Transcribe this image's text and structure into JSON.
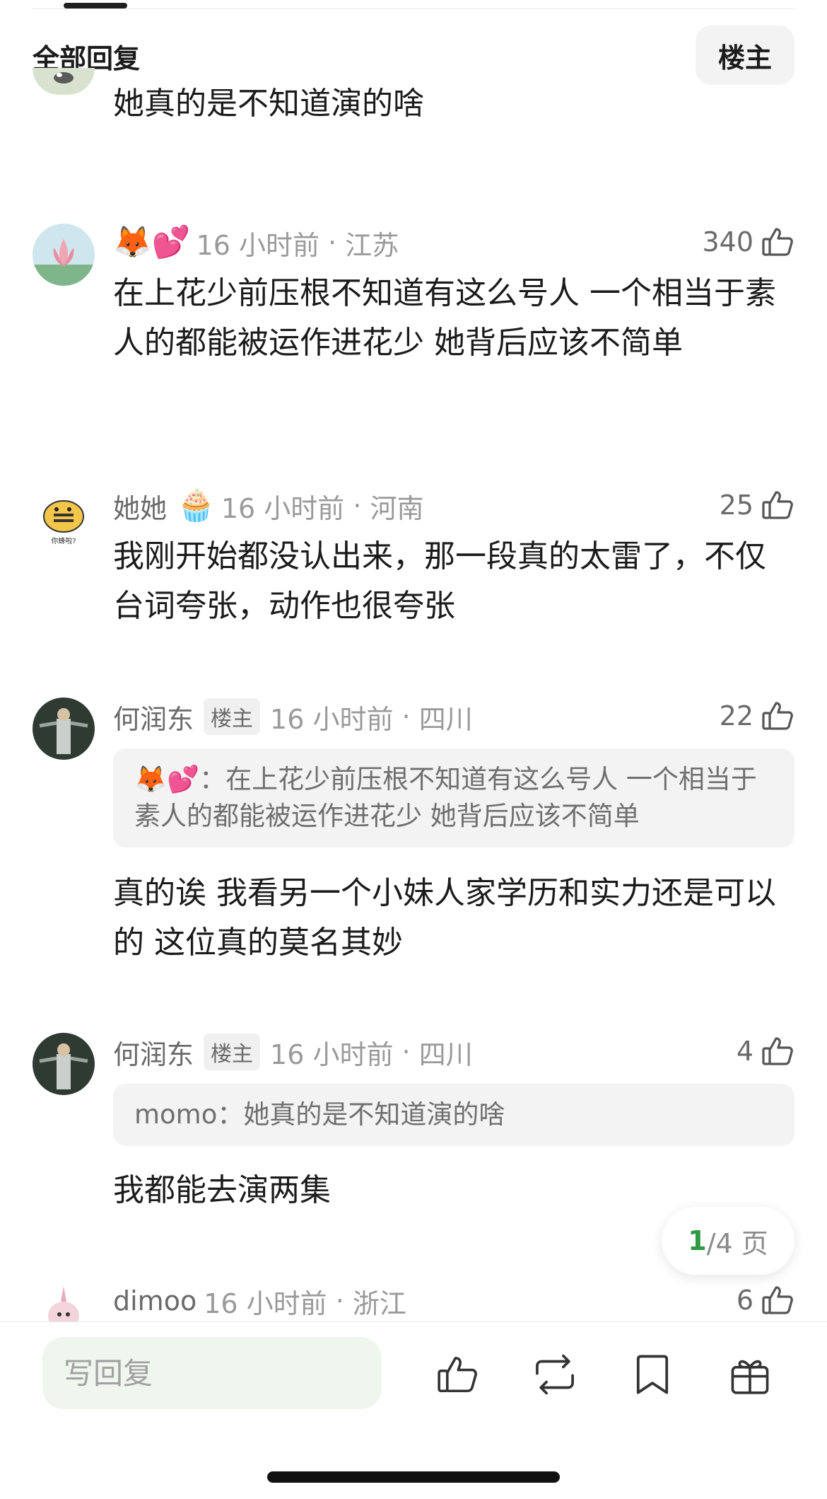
{
  "header": {
    "title": "全部回复",
    "owner_filter": "楼主"
  },
  "comments": [
    {
      "text": "她真的是不知道演的啥"
    },
    {
      "name": "",
      "emoji": "🦊💕",
      "time": "16 小时前",
      "location": "江苏",
      "likes": "340",
      "text": "在上花少前压根不知道有这么号人 一个相当于素人的都能被运作进花少 她背后应该不简单"
    },
    {
      "name": "她她",
      "emoji": "🧁",
      "time": "16 小时前",
      "location": "河南",
      "likes": "25",
      "text": "我刚开始都没认出来，那一段真的太雷了，不仅台词夸张，动作也很夸张"
    },
    {
      "name": "何润东",
      "badge": "楼主",
      "time": "16 小时前",
      "location": "四川",
      "likes": "22",
      "quote_name": "🦊💕：",
      "quote_text": "在上花少前压根不知道有这么号人 一个相当于素人的都能被运作进花少 她背后应该不简单",
      "text": "真的诶 我看另一个小妹人家学历和实力还是可以的 这位真的莫名其妙"
    },
    {
      "name": "何润东",
      "badge": "楼主",
      "time": "16 小时前",
      "location": "四川",
      "likes": "4",
      "quote_name": "momo：",
      "quote_text": "她真的是不知道演的啥",
      "text": "我都能去演两集"
    },
    {
      "name": "dimoo",
      "time": "16 小时前",
      "location": "浙江",
      "likes": "6"
    }
  ],
  "pagination": {
    "current": "1",
    "total": "/4 页"
  },
  "bottom_bar": {
    "reply_placeholder": "写回复"
  },
  "icons": {
    "like": "thumbs-up-icon",
    "repost": "repost-icon",
    "bookmark": "bookmark-icon",
    "gift": "gift-icon"
  },
  "colors": {
    "accent_green": "#2e9a43",
    "reply_bg": "#eef6ee",
    "quote_bg": "#f3f3f3"
  }
}
